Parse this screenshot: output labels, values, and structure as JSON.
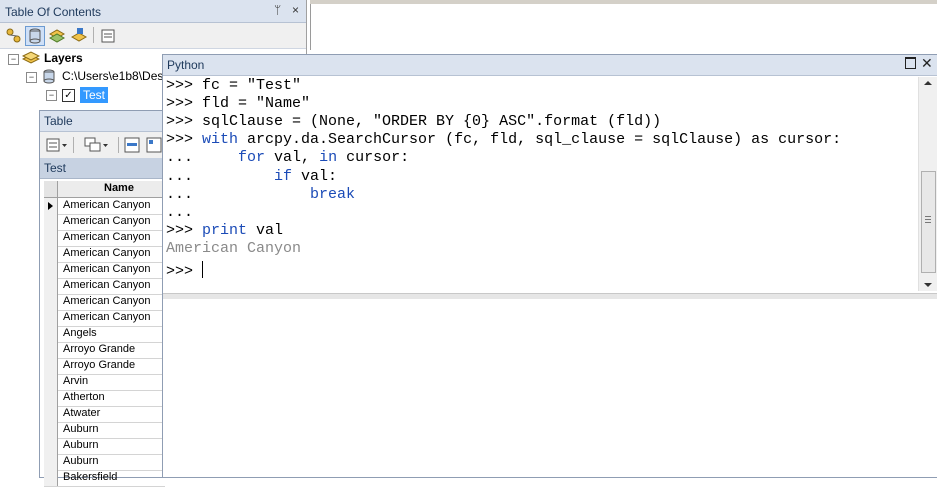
{
  "toc": {
    "title": "Table Of Contents",
    "pin_glyph": "ᛘ",
    "close_glyph": "×",
    "toolbar_icons": [
      "list-by-drawing-order-icon",
      "list-by-source-icon",
      "list-by-visibility-icon",
      "list-by-selection-icon",
      "options-icon"
    ],
    "tree": {
      "root_label": "Layers",
      "source_path": "C:\\Users\\e1b8\\Des",
      "layer_label": "Test"
    }
  },
  "table_window": {
    "title": "Table",
    "tab": "Test",
    "column_header": "Name",
    "rows": [
      "American Canyon",
      "American Canyon",
      "American Canyon",
      "American Canyon",
      "American Canyon",
      "American Canyon",
      "American Canyon",
      "American Canyon",
      "Angels",
      "Arroyo Grande",
      "Arroyo Grande",
      "Arvin",
      "Atherton",
      "Atwater",
      "Auburn",
      "Auburn",
      "Auburn",
      "Bakersfield"
    ]
  },
  "python_window": {
    "title": "Python",
    "console_lines": [
      {
        "prompt": ">>> ",
        "parts": [
          {
            "t": "fc = \"Test\"",
            "c": ""
          }
        ]
      },
      {
        "prompt": ">>> ",
        "parts": [
          {
            "t": "fld = \"Name\"",
            "c": ""
          }
        ]
      },
      {
        "prompt": ">>> ",
        "parts": [
          {
            "t": "sqlClause = (None, \"ORDER BY {0} ASC\".format (fld))",
            "c": ""
          }
        ]
      },
      {
        "prompt": ">>> ",
        "parts": [
          {
            "t": "with",
            "c": "kw"
          },
          {
            "t": " arcpy.da.SearchCursor (fc, fld, sql_clause = sqlClause) as cursor:",
            "c": ""
          }
        ]
      },
      {
        "prompt": "... ",
        "parts": [
          {
            "t": "    ",
            "c": ""
          },
          {
            "t": "for",
            "c": "kw"
          },
          {
            "t": " val, ",
            "c": ""
          },
          {
            "t": "in",
            "c": "kw"
          },
          {
            "t": " cursor:",
            "c": ""
          }
        ]
      },
      {
        "prompt": "... ",
        "parts": [
          {
            "t": "        ",
            "c": ""
          },
          {
            "t": "if",
            "c": "kw"
          },
          {
            "t": " val:",
            "c": ""
          }
        ]
      },
      {
        "prompt": "... ",
        "parts": [
          {
            "t": "            ",
            "c": ""
          },
          {
            "t": "break",
            "c": "kw"
          }
        ]
      },
      {
        "prompt": "...",
        "parts": []
      },
      {
        "prompt": ">>> ",
        "parts": [
          {
            "t": "print",
            "c": "kw"
          },
          {
            "t": " val",
            "c": ""
          }
        ]
      },
      {
        "prompt": "",
        "parts": [
          {
            "t": "American Canyon",
            "c": "out"
          }
        ]
      },
      {
        "prompt": ">>> ",
        "parts": []
      }
    ]
  }
}
